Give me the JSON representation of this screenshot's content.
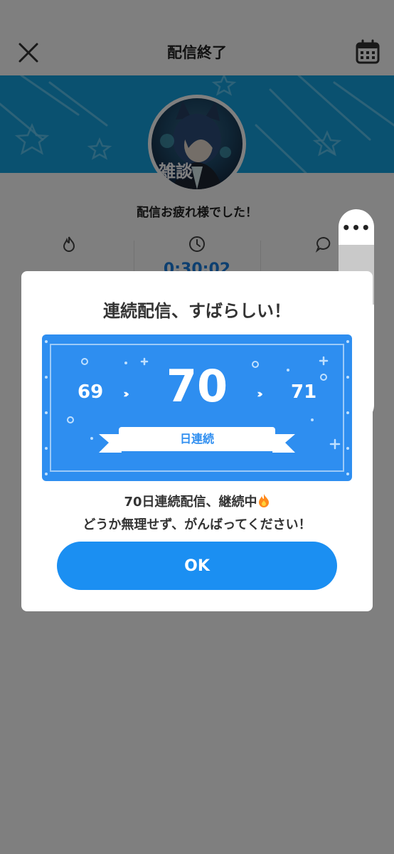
{
  "header": {
    "title": "配信終了",
    "close_icon": "close-icon",
    "calendar_icon": "calendar-icon"
  },
  "banner": {
    "color": "#14a3e0",
    "avatar_tag": "雑談"
  },
  "summary": {
    "thanks": "配信お疲れ様でした！",
    "stats": [
      {
        "icon": "flame-icon",
        "value": ""
      },
      {
        "icon": "clock-icon",
        "value": "0:30:02"
      },
      {
        "icon": "comment-icon",
        "value": ""
      }
    ]
  },
  "side_panel": {
    "more_label": "•••",
    "note_icon": "music-note-icon"
  },
  "modal": {
    "title": "連続配信、すばらしい！",
    "streak": {
      "previous": "69",
      "current": "70",
      "next": "71",
      "unit_label": "日連続"
    },
    "message_line1": "70日連続配信、継続中",
    "message_line2": "どうか無理せず、がんばってください！",
    "ok_label": "OK",
    "accent": "#2e8ef0"
  }
}
